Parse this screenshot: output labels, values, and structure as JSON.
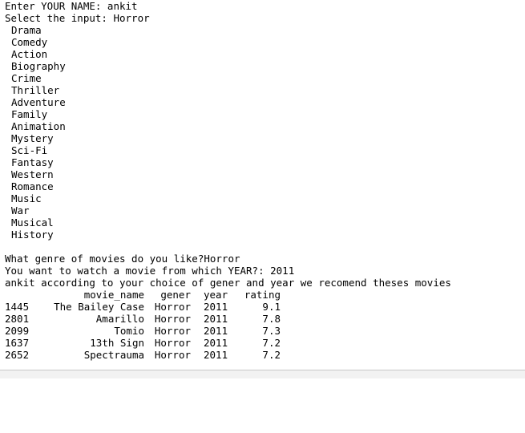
{
  "prompts": {
    "name_line": "Enter YOUR NAME: ankit",
    "select_line": "Select the input: Horror"
  },
  "genres": [
    "Drama",
    "Comedy",
    "Action",
    "Biography",
    "Crime",
    "Thriller",
    "Adventure",
    "Family",
    "Animation",
    "Mystery",
    "Sci-Fi",
    "Fantasy",
    "Western",
    "Romance",
    "Music",
    "War",
    "Musical",
    "History"
  ],
  "questions": {
    "genre_line": "What genre of movies do you like?Horror",
    "year_line": "You want to watch a movie from which YEAR?: 2011",
    "recommend_line": "ankit according to your choice of gener and year we recomend theses movies"
  },
  "table": {
    "headers": {
      "movie_name": "movie_name",
      "gener": "gener",
      "year": "year",
      "rating": "rating"
    },
    "rows": [
      {
        "idx": "1445",
        "movie_name": "The Bailey Case",
        "gener": "Horror",
        "year": "2011",
        "rating": "9.1"
      },
      {
        "idx": "2801",
        "movie_name": "Amarillo",
        "gener": "Horror",
        "year": "2011",
        "rating": "7.8"
      },
      {
        "idx": "2099",
        "movie_name": "Tomio",
        "gener": "Horror",
        "year": "2011",
        "rating": "7.3"
      },
      {
        "idx": "1637",
        "movie_name": "13th Sign",
        "gener": "Horror",
        "year": "2011",
        "rating": "7.2"
      },
      {
        "idx": "2652",
        "movie_name": "Spectrauma",
        "gener": "Horror",
        "year": "2011",
        "rating": "7.2"
      }
    ]
  }
}
